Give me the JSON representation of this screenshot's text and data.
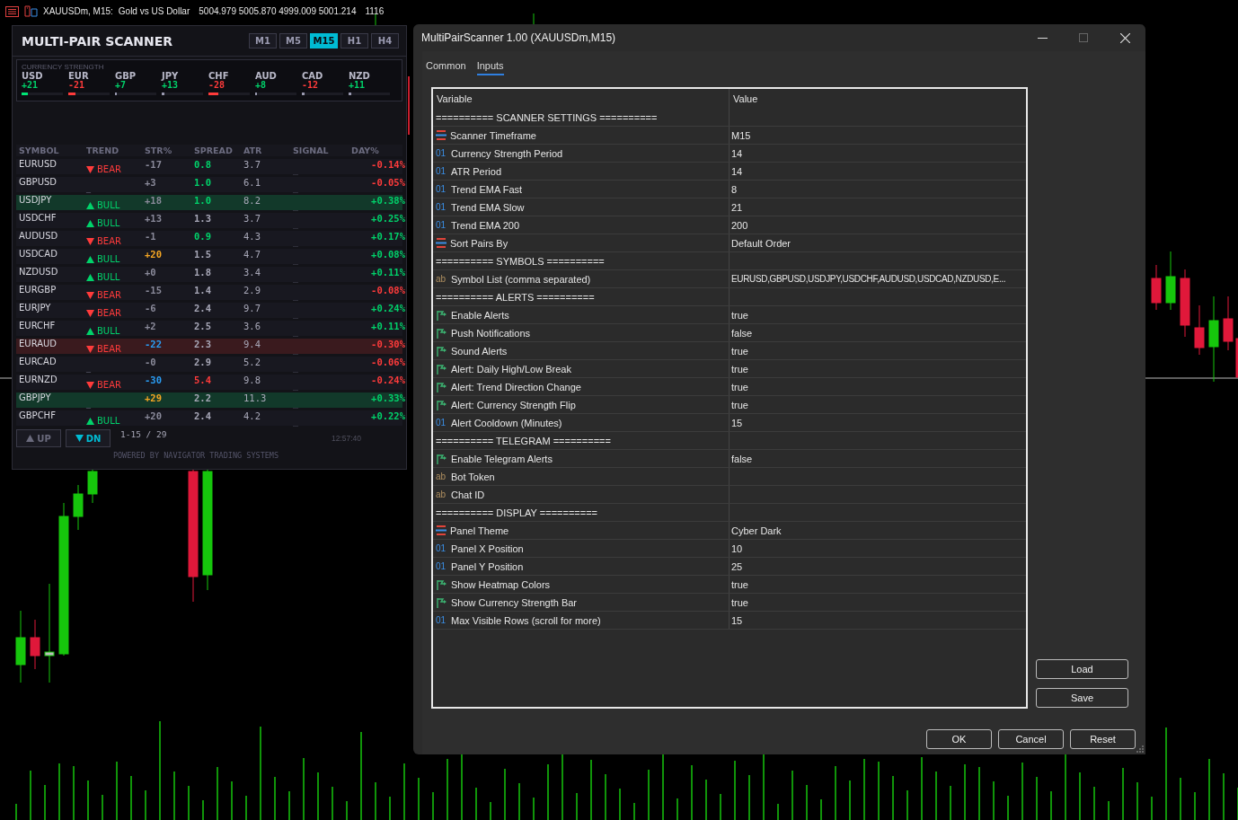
{
  "chart_header": {
    "symbol": "XAUUSDm, M15:",
    "description": "Gold vs US Dollar",
    "quote": "5004.979 5005.870 4999.009 5001.214",
    "volume": "1116"
  },
  "scanner": {
    "title": "MULTI-PAIR SCANNER",
    "timeframes": [
      {
        "label": "M1",
        "selected": false
      },
      {
        "label": "M5",
        "selected": false
      },
      {
        "label": "M15",
        "selected": true
      },
      {
        "label": "H1",
        "selected": false
      },
      {
        "label": "H4",
        "selected": false
      }
    ],
    "strength": {
      "title": "CURRENCY STRENGTH",
      "currencies": [
        {
          "code": "USD",
          "value": "+21",
          "color": "#00d26a",
          "bar": {
            "level": 0.15,
            "color": "#00e676"
          }
        },
        {
          "code": "EUR",
          "value": "-21",
          "color": "#ff3b3b",
          "bar": {
            "level": 0.18,
            "color": "#ff3b3b"
          }
        },
        {
          "code": "GBP",
          "value": "+7",
          "color": "#00d26a",
          "bar": {
            "level": 0.02,
            "color": "#9a9ab0"
          }
        },
        {
          "code": "JPY",
          "value": "+13",
          "color": "#00d26a",
          "bar": {
            "level": 0.07,
            "color": "#9a9ab0"
          }
        },
        {
          "code": "CHF",
          "value": "-28",
          "color": "#ff3b3b",
          "bar": {
            "level": 0.24,
            "color": "#ff3b3b"
          }
        },
        {
          "code": "AUD",
          "value": "+8",
          "color": "#00d26a",
          "bar": {
            "level": 0.04,
            "color": "#9a9ab0"
          }
        },
        {
          "code": "CAD",
          "value": "-12",
          "color": "#ff3b3b",
          "bar": {
            "level": 0.06,
            "color": "#9a9ab0"
          }
        },
        {
          "code": "NZD",
          "value": "+11",
          "color": "#00d26a",
          "bar": {
            "level": 0.06,
            "color": "#9a9ab0"
          }
        }
      ]
    },
    "columns": [
      "SYMBOL",
      "TREND",
      "STR%",
      "SPREAD",
      "ATR",
      "SIGNAL",
      "DAY%"
    ],
    "rows": [
      {
        "kind": "plain",
        "symbol": "EURUSD",
        "trend": {
          "kind": "bear",
          "label": "BEAR"
        },
        "str": {
          "text": "-17",
          "color": "#8a8a9a"
        },
        "spread": {
          "text": "0.8",
          "color": "#00d26a"
        },
        "atr": "3.7",
        "signal": "_",
        "day": {
          "text": "-0.14%",
          "color": "#ff3b3b"
        }
      },
      {
        "kind": "plain",
        "symbol": "GBPUSD",
        "trend": {
          "kind": "none",
          "label": "_"
        },
        "str": {
          "text": "+3",
          "color": "#8a8a9a"
        },
        "spread": {
          "text": "1.0",
          "color": "#00d26a"
        },
        "atr": "6.1",
        "signal": "_",
        "day": {
          "text": "-0.05%",
          "color": "#ff3b3b"
        }
      },
      {
        "kind": "bull",
        "symbol": "USDJPY",
        "trend": {
          "kind": "bull",
          "label": "BULL"
        },
        "str": {
          "text": "+18",
          "color": "#8a8a9a"
        },
        "spread": {
          "text": "1.0",
          "color": "#00d26a"
        },
        "atr": "8.2",
        "signal": "_",
        "day": {
          "text": "+0.38%",
          "color": "#00d26a"
        }
      },
      {
        "kind": "plain",
        "symbol": "USDCHF",
        "trend": {
          "kind": "bull",
          "label": "BULL"
        },
        "str": {
          "text": "+13",
          "color": "#8a8a9a"
        },
        "spread": {
          "text": "1.3",
          "color": "#a8a8b8"
        },
        "atr": "3.7",
        "signal": "_",
        "day": {
          "text": "+0.25%",
          "color": "#00d26a"
        }
      },
      {
        "kind": "plain",
        "symbol": "AUDUSD",
        "trend": {
          "kind": "bear",
          "label": "BEAR"
        },
        "str": {
          "text": "-1",
          "color": "#8a8a9a"
        },
        "spread": {
          "text": "0.9",
          "color": "#00d26a"
        },
        "atr": "4.3",
        "signal": "_",
        "day": {
          "text": "+0.17%",
          "color": "#00d26a"
        }
      },
      {
        "kind": "plain",
        "symbol": "USDCAD",
        "trend": {
          "kind": "bull",
          "label": "BULL"
        },
        "str": {
          "text": "+20",
          "color": "#f5a623"
        },
        "spread": {
          "text": "1.5",
          "color": "#a8a8b8"
        },
        "atr": "4.7",
        "signal": "_",
        "day": {
          "text": "+0.08%",
          "color": "#00d26a"
        }
      },
      {
        "kind": "plain",
        "symbol": "NZDUSD",
        "trend": {
          "kind": "bull",
          "label": "BULL"
        },
        "str": {
          "text": "+0",
          "color": "#8a8a9a"
        },
        "spread": {
          "text": "1.8",
          "color": "#a8a8b8"
        },
        "atr": "3.4",
        "signal": "_",
        "day": {
          "text": "+0.11%",
          "color": "#00d26a"
        }
      },
      {
        "kind": "plain",
        "symbol": "EURGBP",
        "trend": {
          "kind": "bear",
          "label": "BEAR"
        },
        "str": {
          "text": "-15",
          "color": "#8a8a9a"
        },
        "spread": {
          "text": "1.4",
          "color": "#a8a8b8"
        },
        "atr": "2.9",
        "signal": "_",
        "day": {
          "text": "-0.08%",
          "color": "#ff3b3b"
        }
      },
      {
        "kind": "plain",
        "symbol": "EURJPY",
        "trend": {
          "kind": "bear",
          "label": "BEAR"
        },
        "str": {
          "text": "-6",
          "color": "#8a8a9a"
        },
        "spread": {
          "text": "2.4",
          "color": "#a8a8b8"
        },
        "atr": "9.7",
        "signal": "_",
        "day": {
          "text": "+0.24%",
          "color": "#00d26a"
        }
      },
      {
        "kind": "plain",
        "symbol": "EURCHF",
        "trend": {
          "kind": "bull",
          "label": "BULL"
        },
        "str": {
          "text": "+2",
          "color": "#8a8a9a"
        },
        "spread": {
          "text": "2.5",
          "color": "#a8a8b8"
        },
        "atr": "3.6",
        "signal": "_",
        "day": {
          "text": "+0.11%",
          "color": "#00d26a"
        }
      },
      {
        "kind": "bear",
        "symbol": "EURAUD",
        "trend": {
          "kind": "bear",
          "label": "BEAR"
        },
        "str": {
          "text": "-22",
          "color": "#2a9df4"
        },
        "spread": {
          "text": "2.3",
          "color": "#a8a8b8"
        },
        "atr": "9.4",
        "signal": "_",
        "day": {
          "text": "-0.30%",
          "color": "#ff3b3b"
        }
      },
      {
        "kind": "plain",
        "symbol": "EURCAD",
        "trend": {
          "kind": "none",
          "label": "_"
        },
        "str": {
          "text": "-0",
          "color": "#8a8a9a"
        },
        "spread": {
          "text": "2.9",
          "color": "#a8a8b8"
        },
        "atr": "5.2",
        "signal": "_",
        "day": {
          "text": "-0.06%",
          "color": "#ff3b3b"
        }
      },
      {
        "kind": "plain",
        "symbol": "EURNZD",
        "trend": {
          "kind": "bear",
          "label": "BEAR"
        },
        "str": {
          "text": "-30",
          "color": "#2a9df4"
        },
        "spread": {
          "text": "5.4",
          "color": "#ff3b3b"
        },
        "atr": "9.8",
        "signal": "_",
        "day": {
          "text": "-0.24%",
          "color": "#ff3b3b"
        }
      },
      {
        "kind": "bull",
        "symbol": "GBPJPY",
        "trend": {
          "kind": "none",
          "label": "_"
        },
        "str": {
          "text": "+29",
          "color": "#f5a623"
        },
        "spread": {
          "text": "2.2",
          "color": "#a8a8b8"
        },
        "atr": "11.3",
        "signal": "_",
        "day": {
          "text": "+0.33%",
          "color": "#00d26a"
        }
      },
      {
        "kind": "plain",
        "symbol": "GBPCHF",
        "trend": {
          "kind": "bull",
          "label": "BULL"
        },
        "str": {
          "text": "+20",
          "color": "#8a8a9a"
        },
        "spread": {
          "text": "2.4",
          "color": "#a8a8b8"
        },
        "atr": "4.2",
        "signal": "_",
        "day": {
          "text": "+0.22%",
          "color": "#00d26a"
        }
      }
    ],
    "scroll_buttons": [
      {
        "kind": "up",
        "label": "UP",
        "disabled": true
      },
      {
        "kind": "down",
        "label": "DN",
        "disabled": false
      }
    ],
    "page": "1-15 / 29",
    "time": "12:57:40",
    "footer": "POWERED BY NAVIGATOR TRADING SYSTEMS"
  },
  "dialog": {
    "title": "MultiPairScanner 1.00 (XAUUSDm,M15)",
    "tabs": [
      {
        "label": "Common",
        "selected": false
      },
      {
        "label": "Inputs",
        "selected": true
      }
    ],
    "columns": [
      "Variable",
      "Value"
    ],
    "rows": [
      {
        "kind": "section",
        "name": "========== SCANNER SETTINGS =========="
      },
      {
        "kind": "enum",
        "name": "Scanner Timeframe",
        "value": "M15"
      },
      {
        "kind": "int",
        "icon_text": "01",
        "name": "Currency Strength Period",
        "value": "14"
      },
      {
        "kind": "int",
        "icon_text": "01",
        "name": "ATR Period",
        "value": "14"
      },
      {
        "kind": "int",
        "icon_text": "01",
        "name": "Trend EMA Fast",
        "value": "8"
      },
      {
        "kind": "int",
        "icon_text": "01",
        "name": "Trend EMA Slow",
        "value": "21"
      },
      {
        "kind": "int",
        "icon_text": "01",
        "name": "Trend EMA 200",
        "value": "200"
      },
      {
        "kind": "enum",
        "name": "Sort Pairs By",
        "value": "Default Order"
      },
      {
        "kind": "section",
        "name": "========== SYMBOLS =========="
      },
      {
        "kind": "string",
        "icon_text": "ab",
        "name": "Symbol List (comma separated)",
        "value": "EURUSD,GBPUSD,USDJPY,USDCHF,AUDUSD,USDCAD,NZDUSD,E..."
      },
      {
        "kind": "section",
        "name": "========== ALERTS =========="
      },
      {
        "kind": "bool",
        "name": "Enable Alerts",
        "value": "true"
      },
      {
        "kind": "bool",
        "name": "Push Notifications",
        "value": "false"
      },
      {
        "kind": "bool",
        "name": "Sound Alerts",
        "value": "true"
      },
      {
        "kind": "bool",
        "name": "Alert: Daily High/Low Break",
        "value": "true"
      },
      {
        "kind": "bool",
        "name": "Alert: Trend Direction Change",
        "value": "true"
      },
      {
        "kind": "bool",
        "name": "Alert: Currency Strength Flip",
        "value": "true"
      },
      {
        "kind": "int",
        "icon_text": "01",
        "name": "Alert Cooldown (Minutes)",
        "value": "15"
      },
      {
        "kind": "section",
        "name": "========== TELEGRAM =========="
      },
      {
        "kind": "bool",
        "name": "Enable Telegram Alerts",
        "value": "false"
      },
      {
        "kind": "string",
        "icon_text": "ab",
        "name": "Bot Token"
      },
      {
        "kind": "string",
        "icon_text": "ab",
        "name": "Chat ID"
      },
      {
        "kind": "section",
        "name": "========== DISPLAY =========="
      },
      {
        "kind": "enum",
        "name": "Panel Theme",
        "value": "Cyber Dark"
      },
      {
        "kind": "int",
        "icon_text": "01",
        "name": "Panel X Position",
        "value": "10"
      },
      {
        "kind": "int",
        "icon_text": "01",
        "name": "Panel Y Position",
        "value": "25"
      },
      {
        "kind": "bool",
        "name": "Show Heatmap Colors",
        "value": "true"
      },
      {
        "kind": "bool",
        "name": "Show Currency Strength Bar",
        "value": "true"
      },
      {
        "kind": "int",
        "icon_text": "01",
        "name": "Max Visible Rows (scroll for more)",
        "value": "15"
      }
    ],
    "side_buttons": [
      "Load",
      "Save"
    ],
    "buttons": [
      "OK",
      "Cancel",
      "Reset"
    ]
  }
}
